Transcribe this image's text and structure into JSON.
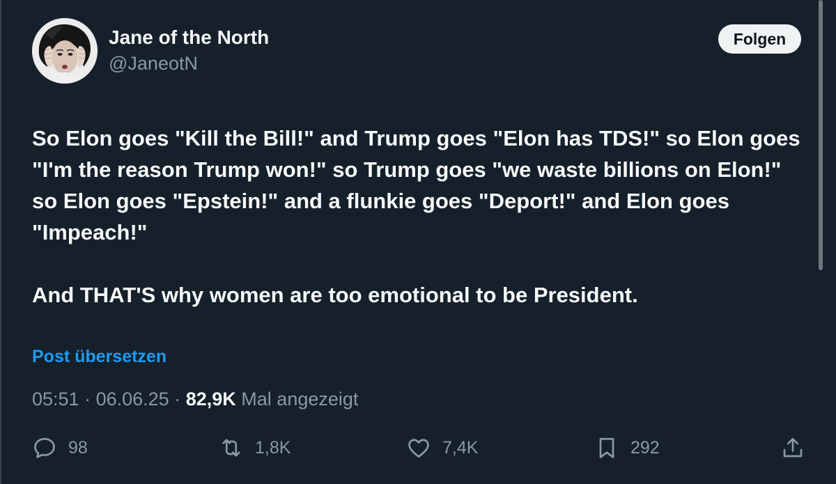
{
  "author": {
    "name": "Jane of the North",
    "handle": "@JaneotN",
    "avatar_icon": "profile-photo"
  },
  "follow_label": "Folgen",
  "post": {
    "paragraph_1": "So Elon goes \"Kill the Bill!\" and Trump goes \"Elon has TDS!\" so Elon goes \"I'm the reason Trump won!\" so Trump goes \"we waste billions on Elon!\" so Elon goes \"Epstein!\" and a flunkie goes \"Deport!\" and Elon goes \"Impeach!\"",
    "paragraph_2": "And THAT'S why women are too emotional to be President."
  },
  "translate_label": "Post übersetzen",
  "meta": {
    "time": "05:51",
    "separator": "·",
    "date": "06.06.25",
    "views_count": "82,9K",
    "views_label": "Mal angezeigt"
  },
  "actions": {
    "replies": "98",
    "reposts": "1,8K",
    "likes": "7,4K",
    "bookmarks": "292"
  },
  "colors": {
    "background": "#15202b",
    "text_primary": "#f7f9f9",
    "text_secondary": "#8b98a5",
    "accent": "#1d9bf0",
    "follow_button_bg": "#eff3f4"
  }
}
